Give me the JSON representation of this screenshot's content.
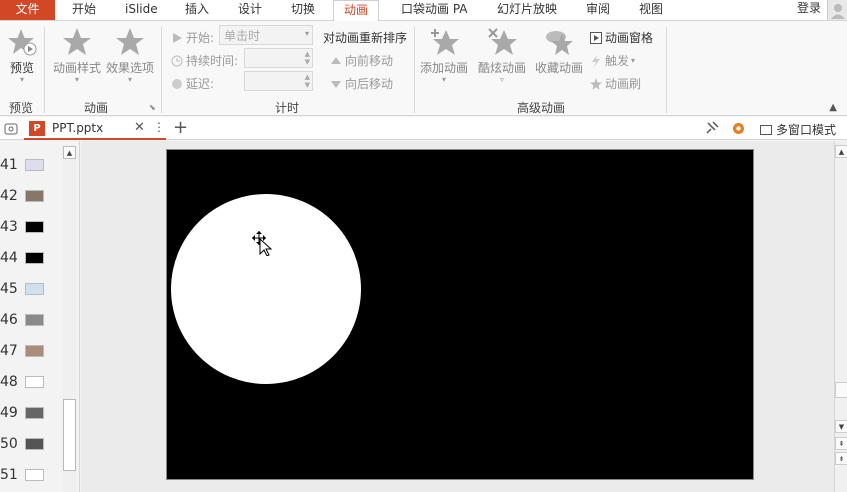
{
  "tabs": [
    {
      "label": "文件"
    },
    {
      "label": "开始"
    },
    {
      "label": "iSlide"
    },
    {
      "label": "插入"
    },
    {
      "label": "设计"
    },
    {
      "label": "切换"
    },
    {
      "label": "动画"
    },
    {
      "label": "口袋动画 PA"
    },
    {
      "label": "幻灯片放映"
    },
    {
      "label": "审阅"
    },
    {
      "label": "视图"
    }
  ],
  "login": "登录",
  "ribbon": {
    "preview": {
      "button": "预览",
      "group": "预览"
    },
    "animation": {
      "style": "动画样式",
      "effects": "效果选项",
      "group": "动画"
    },
    "timing": {
      "start_label": "开始:",
      "start_value": "单击时",
      "duration_label": "持续时间:",
      "delay_label": "延迟:",
      "group": "计时"
    },
    "reorder": {
      "title": "对动画重新排序",
      "forward": "向前移动",
      "backward": "向后移动"
    },
    "advanced": {
      "add": "添加动画",
      "cool": "酷炫动画",
      "fav": "收藏动画",
      "pane": "动画窗格",
      "trigger": "触发",
      "painter": "动画刷",
      "group": "高级动画"
    }
  },
  "doc": {
    "filename": "PPT.pptx",
    "close": "✕",
    "more": "⋮",
    "new_tab": "+",
    "multi_window": "多窗口模式"
  },
  "thumbnails": [
    {
      "num": "41"
    },
    {
      "num": "42"
    },
    {
      "num": "43"
    },
    {
      "num": "44"
    },
    {
      "num": "45"
    },
    {
      "num": "46"
    },
    {
      "num": "47"
    },
    {
      "num": "48"
    },
    {
      "num": "49"
    },
    {
      "num": "50"
    },
    {
      "num": "51"
    }
  ],
  "colors": {
    "accent": "#d24726",
    "slide_bg": "#000000"
  },
  "icons": [
    "star-icon",
    "gear-icon",
    "move-cursor-icon",
    "up-arrow-icon",
    "down-arrow-icon"
  ]
}
